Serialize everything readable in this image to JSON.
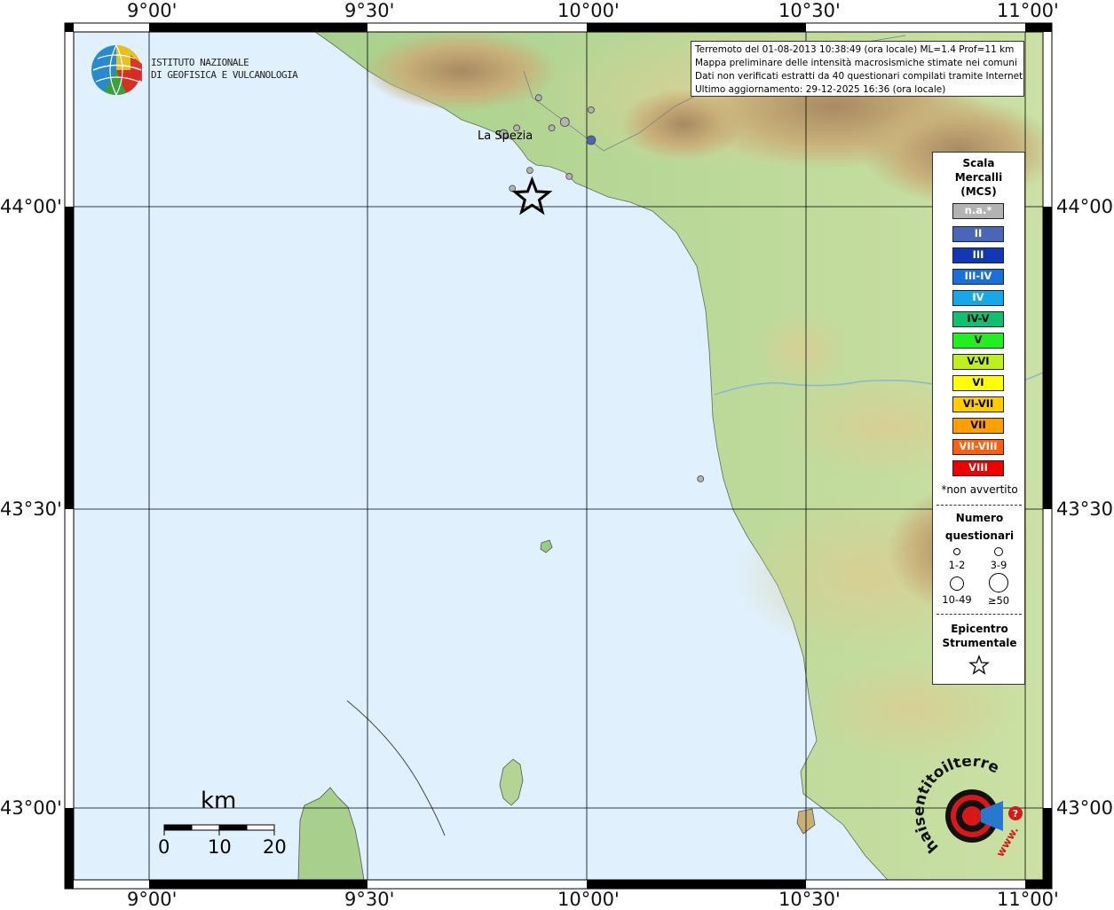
{
  "map": {
    "title_lines": [
      "Terremoto del 01-08-2013 10:38:49 (ora locale) ML=1.4 Prof=11 km",
      "Mappa preliminare delle intensità macrosismiche stimate nei comuni",
      "Dati non verificati estratti da 40 questionari compilati tramite Internet.",
      "Ultimo aggiornamento: 29-12-2025 16:36 (ora locale)"
    ],
    "x_ticks": [
      "9°00'",
      "9°30'",
      "10°00'",
      "10°30'",
      "11°00'"
    ],
    "y_ticks": [
      "44°00'",
      "43°30'",
      "43°00'"
    ],
    "city": "La Spezia",
    "colors": {
      "sea": "#e0f0fc",
      "grid": "#000000",
      "land_low": "#9ccc84",
      "land_mid": "#c8b878",
      "land_high": "#a07850",
      "star_color": "#000000"
    }
  },
  "logo": {
    "org_line1": "ISTITUTO NAZIONALE",
    "org_line2": "DI GEOFISICA E VULCANOLOGIA",
    "icon": "ingv-globe-icon"
  },
  "scale_bar": {
    "unit": "km",
    "labels": [
      "0",
      "10",
      "20"
    ]
  },
  "legend": {
    "title_lines": [
      "Scala",
      "Mercalli",
      "(MCS)"
    ],
    "items": [
      {
        "label": "n.a.*",
        "color": "#b3b3b3",
        "text_color": "#ffffff"
      },
      {
        "label": "II",
        "color": "#4a66b8",
        "text_color": "#ffffff"
      },
      {
        "label": "III",
        "color": "#1238b4",
        "text_color": "#ffffff"
      },
      {
        "label": "III-IV",
        "color": "#1a70d8",
        "text_color": "#ffffff"
      },
      {
        "label": "IV",
        "color": "#18a8e8",
        "text_color": "#ffffff"
      },
      {
        "label": "IV-V",
        "color": "#10c070",
        "text_color": "#000000"
      },
      {
        "label": "V",
        "color": "#22ee22",
        "text_color": "#000000"
      },
      {
        "label": "V-VI",
        "color": "#bef020",
        "text_color": "#000000"
      },
      {
        "label": "VI",
        "color": "#ffff00",
        "text_color": "#000000"
      },
      {
        "label": "VI-VII",
        "color": "#ffcc00",
        "text_color": "#000000"
      },
      {
        "label": "VII",
        "color": "#ffa000",
        "text_color": "#000000"
      },
      {
        "label": "VII-VIII",
        "color": "#ff6010",
        "text_color": "#ffffff"
      },
      {
        "label": "VIII",
        "color": "#ee0000",
        "text_color": "#ffffff"
      }
    ],
    "na_note": "*non avvertito",
    "questionnaires_title_lines": [
      "Numero",
      "questionari"
    ],
    "questionnaire_sizes": [
      "1-2",
      "3-9",
      "10-49",
      "≥50"
    ],
    "epicenter_title_lines": [
      "Epicentro",
      "Strumentale"
    ]
  },
  "observations": [
    {
      "lon": 9.89,
      "lat": 44.18,
      "mcs": "n.a.*",
      "responses": "1-2"
    },
    {
      "lon": 9.92,
      "lat": 44.13,
      "mcs": "n.a.*",
      "responses": "1-2"
    },
    {
      "lon": 9.84,
      "lat": 44.13,
      "mcs": "n.a.*",
      "responses": "1-2"
    },
    {
      "lon": 9.95,
      "lat": 44.14,
      "mcs": "n.a.*",
      "responses": "3-9"
    },
    {
      "lon": 9.81,
      "lat": 44.12,
      "mcs": "n.a.*",
      "responses": "3-9"
    },
    {
      "lon": 10.01,
      "lat": 44.16,
      "mcs": "n.a.*",
      "responses": "1-2"
    },
    {
      "lon": 10.01,
      "lat": 44.11,
      "mcs": "II",
      "responses": "3-9"
    },
    {
      "lon": 9.87,
      "lat": 44.06,
      "mcs": "n.a.*",
      "responses": "1-2"
    },
    {
      "lon": 9.96,
      "lat": 44.05,
      "mcs": "n.a.*",
      "responses": "1-2"
    },
    {
      "lon": 9.83,
      "lat": 44.03,
      "mcs": "n.a.*",
      "responses": "1-2"
    },
    {
      "lon": 10.26,
      "lat": 43.55,
      "mcs": "n.a.*",
      "responses": "1-2"
    }
  ],
  "epicenter": {
    "lon": 9.875,
    "lat": 44.015
  },
  "badge": {
    "text": "haisentitoilterremoto.it",
    "url_text": "www.",
    "icon": "megaphone-icon"
  }
}
